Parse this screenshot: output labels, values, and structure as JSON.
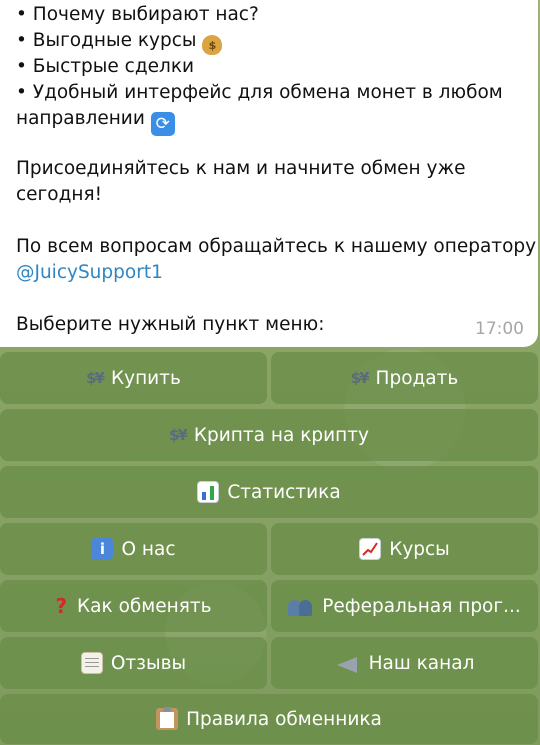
{
  "message": {
    "lines": [
      "• Почему выбирают нас?",
      "• Выгодные курсы",
      "• Быстрые сделки",
      "• Удобный интерфейс для обмена монет в любом",
      "направлении",
      "Присоединяйтесь к нам и начните обмен уже",
      "сегодня!",
      "По всем вопросам обращайтесь к нашему оператору",
      "@JuicySupport1",
      "Выберите нужный пункт меню:"
    ],
    "time": "17:00"
  },
  "keyboard": {
    "buy": "Купить",
    "sell": "Продать",
    "crypto_to_crypto": "Крипта на крипту",
    "statistics": "Статистика",
    "about": "О нас",
    "rates": "Курсы",
    "how_to_exchange": "Как обменять",
    "referral": "Реферальная прог...",
    "reviews": "Отзывы",
    "our_channel": "Наш канал",
    "rules": "Правила обменника"
  },
  "icons": {
    "exchange": "currency-exchange-icon",
    "money_bag": "money-bag-icon",
    "refresh": "refresh-icon",
    "stats": "bar-chart-icon",
    "info": "info-icon",
    "trend": "chart-increasing-icon",
    "question": "red-question-mark-icon",
    "people": "busts-icon",
    "memo": "memo-icon",
    "megaphone": "loudspeaker-icon",
    "clipboard": "clipboard-icon"
  },
  "colors": {
    "link": "#2f86c3",
    "button_bg": "#688c46",
    "timestamp": "#a7a7a7"
  }
}
